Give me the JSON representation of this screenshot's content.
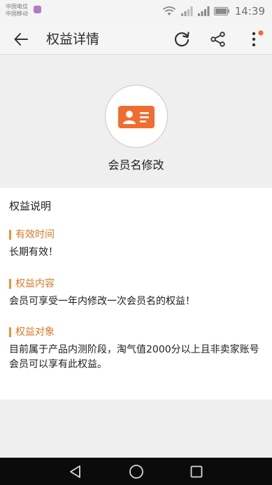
{
  "status_bar": {
    "carrier1": "中国电信",
    "carrier2": "中国移动",
    "time": "14:39"
  },
  "toolbar": {
    "title": "权益详情",
    "icons": [
      "back-arrow-icon",
      "refresh-icon",
      "share-icon",
      "more-icon"
    ],
    "notification_dot_color": "#f06a2a"
  },
  "hero": {
    "title": "会员名修改",
    "icon": "member-card-icon",
    "accent_color": "#f16d2f"
  },
  "content": {
    "heading": "权益说明",
    "sections": [
      {
        "label": "有效时间",
        "text": "长期有效！"
      },
      {
        "label": "权益内容",
        "text": "会员可享受一年内修改一次会员名的权益！"
      },
      {
        "label": "权益对象",
        "text": "目前属于产品内测阶段，淘气值2000分以上且非卖家账号会员可以享有此权益。"
      }
    ]
  },
  "nav_bar": {
    "icons": [
      "nav-back-icon",
      "nav-home-icon",
      "nav-recent-icon"
    ]
  }
}
